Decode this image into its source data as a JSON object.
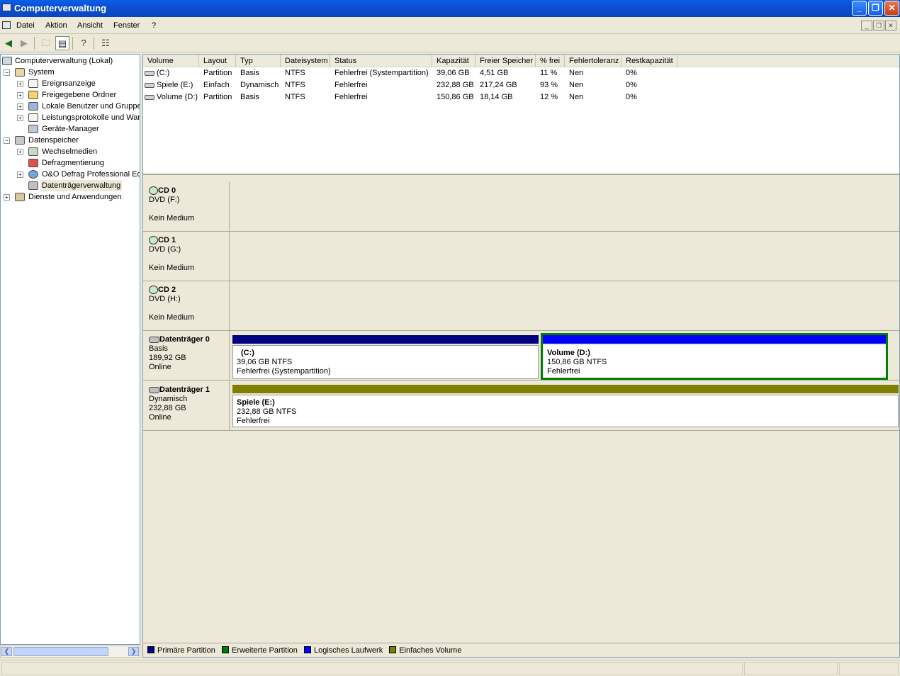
{
  "window": {
    "title": "Computerverwaltung",
    "icon": "computer-icon",
    "controls": {
      "minimize": "_",
      "restore": "❐",
      "close": "✕"
    }
  },
  "menu": {
    "items": [
      "Datei",
      "Aktion",
      "Ansicht",
      "Fenster",
      "?"
    ],
    "mdi_controls": [
      "_",
      "❐",
      "✕"
    ]
  },
  "toolbar": {
    "icons": [
      "back-icon",
      "forward-icon",
      "up-folder-icon",
      "show-tree-icon",
      "help-icon",
      "properties-icon"
    ]
  },
  "tree": {
    "root": "Computerverwaltung (Lokal)",
    "system": "System",
    "ereignis": "Ereignsanzeige",
    "freigabe": "Freigegebene Ordner",
    "benutzer": "Lokale Benutzer und Gruppen",
    "leistung": "Leistungsprotokolle und Warn",
    "geraete": "Geräte-Manager",
    "speicher": "Datenspeicher",
    "wechsel": "Wechselmedien",
    "defrag": "Defragmentierung",
    "oo": "O&O Defrag Professional Edi",
    "dtv": "Datenträgerverwaltung",
    "dienste": "Dienste und Anwendungen",
    "expand_plus": "+",
    "expand_minus": "−"
  },
  "volumes": {
    "headers": [
      "Volume",
      "Layout",
      "Typ",
      "Dateisystem",
      "Status",
      "Kapazität",
      "Freier Speicher",
      "% frei",
      "Fehlertoleranz",
      "Restkapazität"
    ],
    "rows": [
      [
        "(C:)",
        "Partition",
        "Basis",
        "NTFS",
        "Fehlerfrei (Systempartition)",
        "39,06 GB",
        "4,51 GB",
        "11 %",
        "Nen",
        "0%"
      ],
      [
        "Spiele (E:)",
        "Einfach",
        "Dynamisch",
        "NTFS",
        "Fehlerfrei",
        "232,88 GB",
        "217,24 GB",
        "93 %",
        "Nen",
        "0%"
      ],
      [
        "Volume (D:)",
        "Partition",
        "Basis",
        "NTFS",
        "Fehlerfrei",
        "150,86 GB",
        "18,14 GB",
        "12 %",
        "Nen",
        "0%"
      ]
    ]
  },
  "disks": {
    "cd0": {
      "name": "CD 0",
      "type": "DVD (F:)",
      "status": "Kein Medium"
    },
    "cd1": {
      "name": "CD 1",
      "type": "DVD (G:)",
      "status": "Kein Medium"
    },
    "cd2": {
      "name": "CD 2",
      "type": "DVD (H:)",
      "status": "Kein Medium"
    },
    "d0": {
      "name": "Datenträger 0",
      "type": "Basis",
      "size": "189,92 GB",
      "status": "Online",
      "vol_c": {
        "label": "(C:)",
        "size": "39,06 GB NTFS",
        "status": "Fehlerfrei (Systempartition)"
      },
      "vol_d": {
        "label": "Volume  (D:)",
        "size": "150,86 GB NTFS",
        "status": "Fehlerfrei"
      }
    },
    "d1": {
      "name": "Datenträger 1",
      "type": "Dynamisch",
      "size": "232,88 GB",
      "status": "Online",
      "vol_e": {
        "label": "Spiele  (E:)",
        "size": "232,88 GB NTFS",
        "status": "Fehlerfrei"
      }
    }
  },
  "legend": [
    "Primäre Partition",
    "Erweiterte Partition",
    "Logisches Laufwerk",
    "Einfaches Volume"
  ],
  "colors": {
    "primary": "#000080",
    "extended": "#008000",
    "logical": "#0000ff",
    "simple": "#808000",
    "titlebar": "#0a5fe8"
  }
}
